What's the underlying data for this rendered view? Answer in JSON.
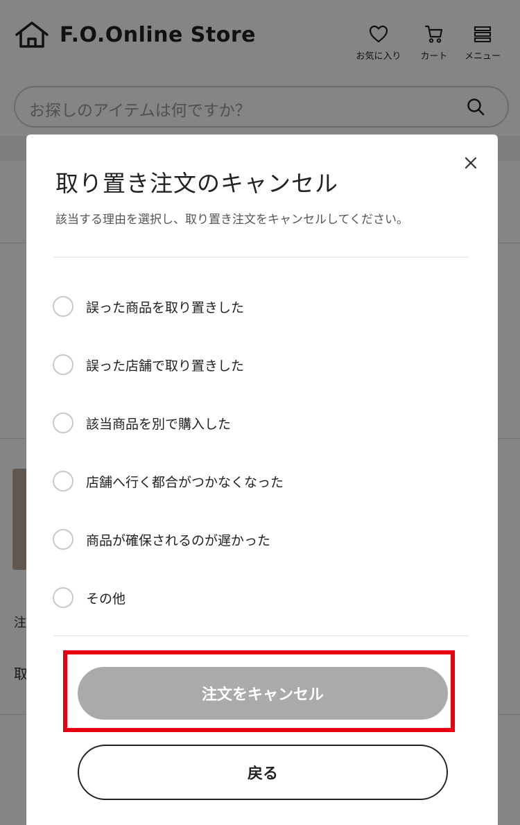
{
  "header": {
    "store_name": "F.O.Online Store",
    "favorites_label": "お気に入り",
    "cart_label": "カート",
    "menu_label": "メニュー"
  },
  "search": {
    "placeholder": "お探しのアイテムは何ですか？"
  },
  "background": {
    "char1": "注",
    "char2": "取"
  },
  "modal": {
    "title": "取り置き注文のキャンセル",
    "description": "該当する理由を選択し、取り置き注文をキャンセルしてください。",
    "options": [
      "誤った商品を取り置きした",
      "誤った店舗で取り置きした",
      "該当商品を別で購入した",
      "店舗へ行く都合がつかなくなった",
      "商品が確保されるのが遅かった",
      "その他"
    ],
    "cancel_button": "注文をキャンセル",
    "back_button": "戻る"
  },
  "colors": {
    "highlight": "#e60012",
    "disabled_button": "#aaaaaa",
    "overlay": "rgba(0,0,0,0.48)"
  },
  "icons": [
    "home-icon",
    "heart-icon",
    "cart-icon",
    "menu-icon",
    "search-icon",
    "close-icon"
  ]
}
